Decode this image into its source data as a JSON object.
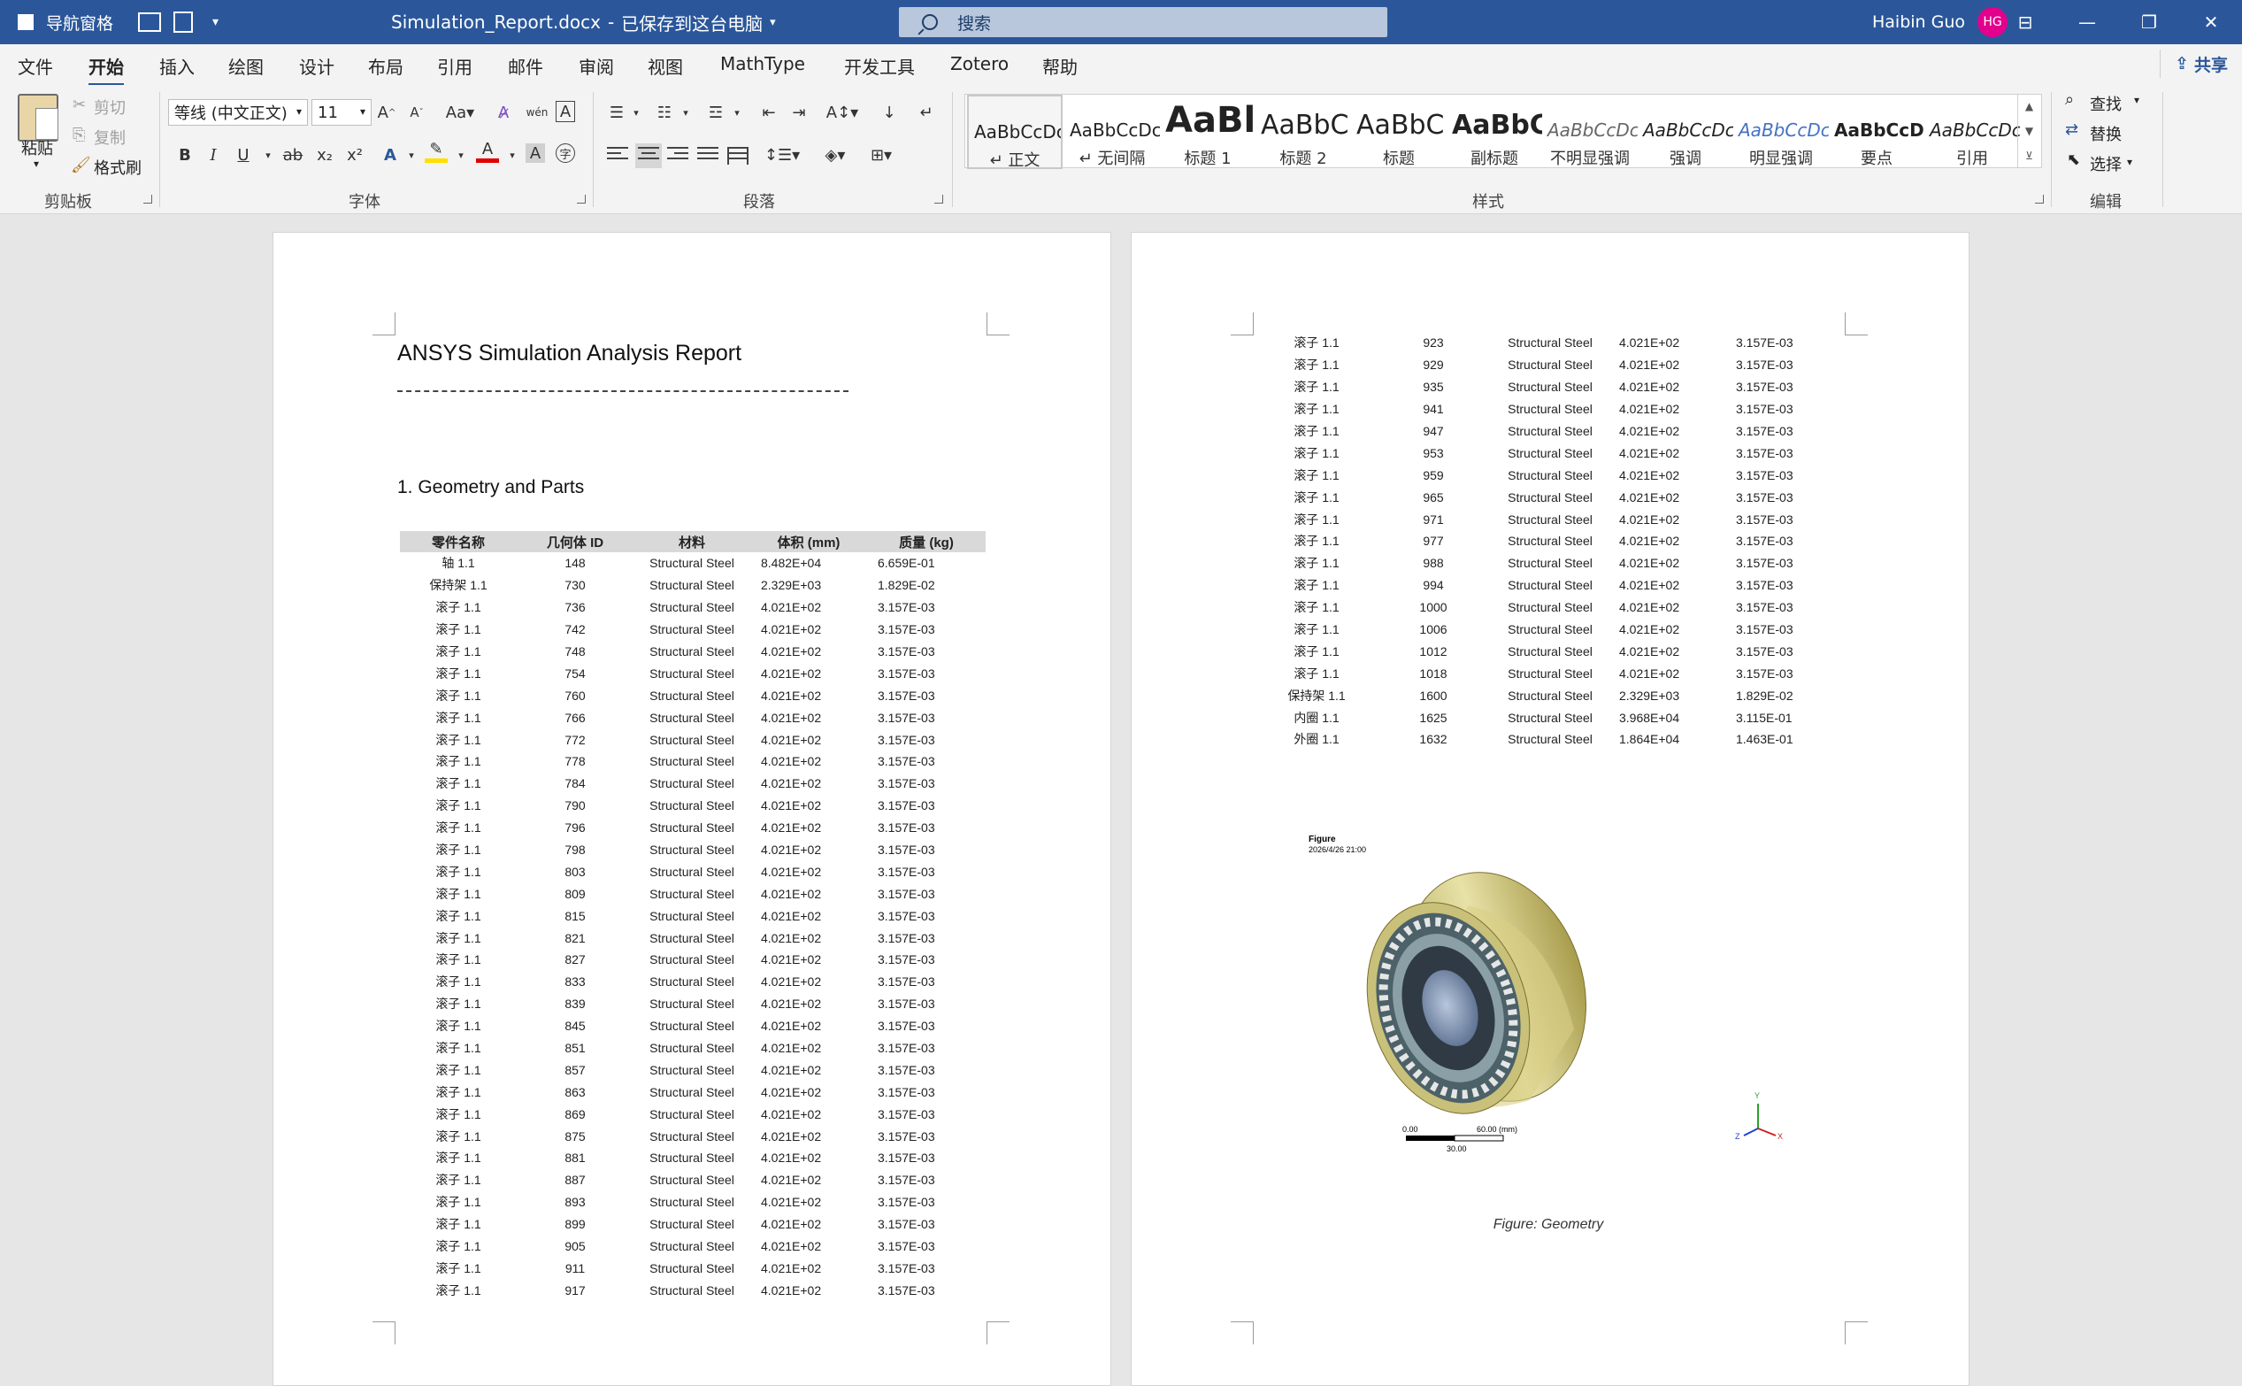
{
  "titlebar": {
    "nav_pane": "导航窗格",
    "doc_title": "Simulation_Report.docx",
    "save_status": "已保存到这台电脑",
    "search_placeholder": "搜索",
    "user_name": "Haibin Guo",
    "user_initials": "HG"
  },
  "menu": {
    "tabs": [
      "文件",
      "开始",
      "插入",
      "绘图",
      "设计",
      "布局",
      "引用",
      "邮件",
      "审阅",
      "视图",
      "MathType",
      "开发工具",
      "Zotero",
      "帮助"
    ],
    "active": "开始",
    "share": "共享"
  },
  "ribbon": {
    "clipboard": {
      "paste": "粘贴",
      "cut": "剪切",
      "copy": "复制",
      "format_painter": "格式刷",
      "label": "剪贴板"
    },
    "font": {
      "font_name": "等线 (中文正文)",
      "font_size": "11",
      "label": "字体",
      "bold": "B",
      "italic": "I",
      "underline": "U",
      "strike": "ab",
      "sub": "x₂",
      "sup": "x²"
    },
    "paragraph": {
      "label": "段落"
    },
    "styles": {
      "label": "样式",
      "items": [
        {
          "sample": "AaBbCcDc",
          "name": "正文"
        },
        {
          "sample": "AaBbCcDc",
          "name": "无间隔"
        },
        {
          "sample": "AaBl",
          "name": "标题 1"
        },
        {
          "sample": "AaBbC",
          "name": "标题 2"
        },
        {
          "sample": "AaBbC",
          "name": "标题"
        },
        {
          "sample": "AaBbC",
          "name": "副标题"
        },
        {
          "sample": "AaBbCcDc",
          "name": "不明显强调"
        },
        {
          "sample": "AaBbCcDc",
          "name": "强调"
        },
        {
          "sample": "AaBbCcDc",
          "name": "明显强调"
        },
        {
          "sample": "AaBbCcD",
          "name": "要点"
        },
        {
          "sample": "AaBbCcDc",
          "name": "引用"
        }
      ]
    },
    "editing": {
      "find": "查找",
      "replace": "替换",
      "select": "选择",
      "label": "编辑"
    }
  },
  "document": {
    "title": "ANSYS Simulation Analysis Report",
    "section1": "1. Geometry and Parts",
    "table_headers": [
      "零件名称",
      "几何体 ID",
      "材料",
      "体积 (mm)",
      "质量 (kg)"
    ],
    "rows_page1": [
      [
        "轴 1.1",
        "148",
        "Structural Steel",
        "8.482E+04",
        "6.659E-01"
      ],
      [
        "保持架 1.1",
        "730",
        "Structural Steel",
        "2.329E+03",
        "1.829E-02"
      ],
      [
        "滚子 1.1",
        "736",
        "Structural Steel",
        "4.021E+02",
        "3.157E-03"
      ],
      [
        "滚子 1.1",
        "742",
        "Structural Steel",
        "4.021E+02",
        "3.157E-03"
      ],
      [
        "滚子 1.1",
        "748",
        "Structural Steel",
        "4.021E+02",
        "3.157E-03"
      ],
      [
        "滚子 1.1",
        "754",
        "Structural Steel",
        "4.021E+02",
        "3.157E-03"
      ],
      [
        "滚子 1.1",
        "760",
        "Structural Steel",
        "4.021E+02",
        "3.157E-03"
      ],
      [
        "滚子 1.1",
        "766",
        "Structural Steel",
        "4.021E+02",
        "3.157E-03"
      ],
      [
        "滚子 1.1",
        "772",
        "Structural Steel",
        "4.021E+02",
        "3.157E-03"
      ],
      [
        "滚子 1.1",
        "778",
        "Structural Steel",
        "4.021E+02",
        "3.157E-03"
      ],
      [
        "滚子 1.1",
        "784",
        "Structural Steel",
        "4.021E+02",
        "3.157E-03"
      ],
      [
        "滚子 1.1",
        "790",
        "Structural Steel",
        "4.021E+02",
        "3.157E-03"
      ],
      [
        "滚子 1.1",
        "796",
        "Structural Steel",
        "4.021E+02",
        "3.157E-03"
      ],
      [
        "滚子 1.1",
        "798",
        "Structural Steel",
        "4.021E+02",
        "3.157E-03"
      ],
      [
        "滚子 1.1",
        "803",
        "Structural Steel",
        "4.021E+02",
        "3.157E-03"
      ],
      [
        "滚子 1.1",
        "809",
        "Structural Steel",
        "4.021E+02",
        "3.157E-03"
      ],
      [
        "滚子 1.1",
        "815",
        "Structural Steel",
        "4.021E+02",
        "3.157E-03"
      ],
      [
        "滚子 1.1",
        "821",
        "Structural Steel",
        "4.021E+02",
        "3.157E-03"
      ],
      [
        "滚子 1.1",
        "827",
        "Structural Steel",
        "4.021E+02",
        "3.157E-03"
      ],
      [
        "滚子 1.1",
        "833",
        "Structural Steel",
        "4.021E+02",
        "3.157E-03"
      ],
      [
        "滚子 1.1",
        "839",
        "Structural Steel",
        "4.021E+02",
        "3.157E-03"
      ],
      [
        "滚子 1.1",
        "845",
        "Structural Steel",
        "4.021E+02",
        "3.157E-03"
      ],
      [
        "滚子 1.1",
        "851",
        "Structural Steel",
        "4.021E+02",
        "3.157E-03"
      ],
      [
        "滚子 1.1",
        "857",
        "Structural Steel",
        "4.021E+02",
        "3.157E-03"
      ],
      [
        "滚子 1.1",
        "863",
        "Structural Steel",
        "4.021E+02",
        "3.157E-03"
      ],
      [
        "滚子 1.1",
        "869",
        "Structural Steel",
        "4.021E+02",
        "3.157E-03"
      ],
      [
        "滚子 1.1",
        "875",
        "Structural Steel",
        "4.021E+02",
        "3.157E-03"
      ],
      [
        "滚子 1.1",
        "881",
        "Structural Steel",
        "4.021E+02",
        "3.157E-03"
      ],
      [
        "滚子 1.1",
        "887",
        "Structural Steel",
        "4.021E+02",
        "3.157E-03"
      ],
      [
        "滚子 1.1",
        "893",
        "Structural Steel",
        "4.021E+02",
        "3.157E-03"
      ],
      [
        "滚子 1.1",
        "899",
        "Structural Steel",
        "4.021E+02",
        "3.157E-03"
      ],
      [
        "滚子 1.1",
        "905",
        "Structural Steel",
        "4.021E+02",
        "3.157E-03"
      ],
      [
        "滚子 1.1",
        "911",
        "Structural Steel",
        "4.021E+02",
        "3.157E-03"
      ],
      [
        "滚子 1.1",
        "917",
        "Structural Steel",
        "4.021E+02",
        "3.157E-03"
      ]
    ],
    "rows_page2": [
      [
        "滚子 1.1",
        "923",
        "Structural Steel",
        "4.021E+02",
        "3.157E-03"
      ],
      [
        "滚子 1.1",
        "929",
        "Structural Steel",
        "4.021E+02",
        "3.157E-03"
      ],
      [
        "滚子 1.1",
        "935",
        "Structural Steel",
        "4.021E+02",
        "3.157E-03"
      ],
      [
        "滚子 1.1",
        "941",
        "Structural Steel",
        "4.021E+02",
        "3.157E-03"
      ],
      [
        "滚子 1.1",
        "947",
        "Structural Steel",
        "4.021E+02",
        "3.157E-03"
      ],
      [
        "滚子 1.1",
        "953",
        "Structural Steel",
        "4.021E+02",
        "3.157E-03"
      ],
      [
        "滚子 1.1",
        "959",
        "Structural Steel",
        "4.021E+02",
        "3.157E-03"
      ],
      [
        "滚子 1.1",
        "965",
        "Structural Steel",
        "4.021E+02",
        "3.157E-03"
      ],
      [
        "滚子 1.1",
        "971",
        "Structural Steel",
        "4.021E+02",
        "3.157E-03"
      ],
      [
        "滚子 1.1",
        "977",
        "Structural Steel",
        "4.021E+02",
        "3.157E-03"
      ],
      [
        "滚子 1.1",
        "988",
        "Structural Steel",
        "4.021E+02",
        "3.157E-03"
      ],
      [
        "滚子 1.1",
        "994",
        "Structural Steel",
        "4.021E+02",
        "3.157E-03"
      ],
      [
        "滚子 1.1",
        "1000",
        "Structural Steel",
        "4.021E+02",
        "3.157E-03"
      ],
      [
        "滚子 1.1",
        "1006",
        "Structural Steel",
        "4.021E+02",
        "3.157E-03"
      ],
      [
        "滚子 1.1",
        "1012",
        "Structural Steel",
        "4.021E+02",
        "3.157E-03"
      ],
      [
        "滚子 1.1",
        "1018",
        "Structural Steel",
        "4.021E+02",
        "3.157E-03"
      ],
      [
        "保持架 1.1",
        "1600",
        "Structural Steel",
        "2.329E+03",
        "1.829E-02"
      ],
      [
        "内圈 1.1",
        "1625",
        "Structural Steel",
        "3.968E+04",
        "3.115E-01"
      ],
      [
        "外圈 1.1",
        "1632",
        "Structural Steel",
        "1.864E+04",
        "1.463E-01"
      ]
    ],
    "figure": {
      "label": "Figure",
      "timestamp": "2026/4/26 21:00",
      "scale_min": "0.00",
      "scale_max": "60.00 (mm)",
      "scale_mid": "30.00",
      "axis_x": "X",
      "axis_y": "Y",
      "axis_z": "Z",
      "caption": "Figure: Geometry"
    }
  },
  "colors": {
    "accent": "#2b579a",
    "avatar": "#e3008c",
    "header_row": "#d9d9d9"
  }
}
